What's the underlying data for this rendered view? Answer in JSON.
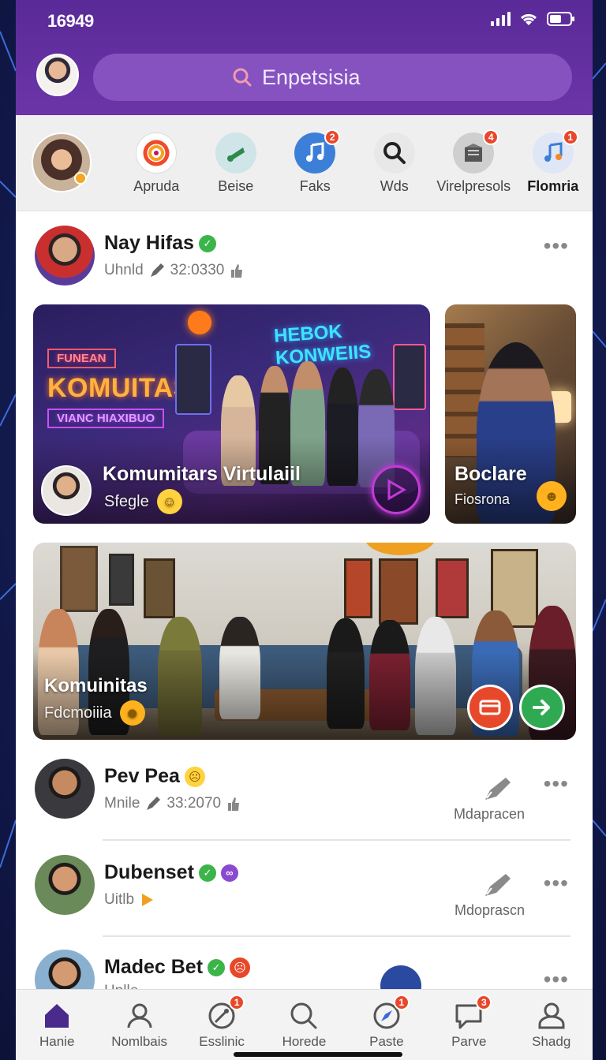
{
  "status_bar": {
    "time": "16949"
  },
  "search": {
    "placeholder": "Enpetsisia"
  },
  "stories": [
    {
      "label": "Apruda",
      "icon": "swirl-icon",
      "badge": ""
    },
    {
      "label": "Beise",
      "icon": "music-note-icon",
      "badge": ""
    },
    {
      "label": "Faks",
      "icon": "music-note-icon",
      "badge": "2"
    },
    {
      "label": "Wds",
      "icon": "search-icon",
      "badge": ""
    },
    {
      "label": "Virelpresols",
      "icon": "box-icon",
      "badge": "4"
    },
    {
      "label": "Flomria",
      "icon": "music-note-icon",
      "badge": "1"
    }
  ],
  "post": {
    "author": "Nay Hifas",
    "meta": "Uhnld",
    "time": "32:0330",
    "more": "•••"
  },
  "card_main": {
    "neon_top": "FUNEAN",
    "neon_big": "KOMUITAS",
    "neon_bottom": "VIANC HIAXIBUO",
    "neon_sign": "HEBOK KONWEIIS",
    "title": "Komumitars  Virtulaiil",
    "subtitle": "Sfegle"
  },
  "card_side": {
    "title": "Boclare",
    "subtitle": "Fiosrona"
  },
  "card_wide": {
    "title": "Komuinitas",
    "subtitle": "Fdcmoiiia"
  },
  "list": [
    {
      "name": "Pev Pea",
      "meta": "Mnile",
      "time": "33:2070",
      "action": "Mdapracen",
      "more": "•••"
    },
    {
      "name": "Dubenset",
      "meta": "Uitlb",
      "time": "",
      "action": "Mdoprascn",
      "more": "•••"
    },
    {
      "name": "Madec Bet",
      "meta": "Hnlle",
      "time": "",
      "action": "",
      "more": "•••"
    }
  ],
  "nav": [
    {
      "label": "Hanie",
      "icon": "home-icon",
      "badge": ""
    },
    {
      "label": "Nomlbais",
      "icon": "person-icon",
      "badge": ""
    },
    {
      "label": "Esslinic",
      "icon": "tool-icon",
      "badge": "1"
    },
    {
      "label": "Horede",
      "icon": "search-icon",
      "badge": ""
    },
    {
      "label": "Paste",
      "icon": "compass-icon",
      "badge": "1"
    },
    {
      "label": "Parve",
      "icon": "chat-icon",
      "badge": "3"
    },
    {
      "label": "Shadg",
      "icon": "profile-icon",
      "badge": ""
    }
  ],
  "colors": {
    "header": "#5a2a98",
    "accent": "#3bb54a",
    "badge": "#e9472b"
  }
}
